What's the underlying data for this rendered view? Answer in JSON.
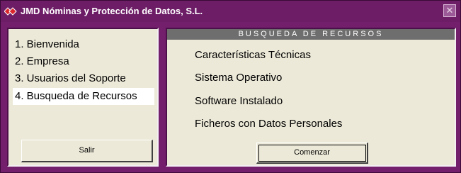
{
  "window": {
    "title": "JMD Nóminas y Protección de Datos, S.L.",
    "close_label": "✕"
  },
  "steps": [
    {
      "label": "1. Bienvenida"
    },
    {
      "label": "2. Empresa"
    },
    {
      "label": "3. Usuarios del Soporte"
    },
    {
      "label": "4. Busqueda de Recursos"
    }
  ],
  "active_step": 4,
  "left_panel": {
    "exit_label": "Salir"
  },
  "right_panel": {
    "header": "BUSQUEDA DE RECURSOS",
    "resources": [
      {
        "label": "Características Técnicas"
      },
      {
        "label": "Sistema Operativo"
      },
      {
        "label": "Software Instalado"
      },
      {
        "label": "Ficheros con Datos Personales"
      }
    ],
    "start_label": "Comenzar"
  },
  "colors": {
    "window_frame": "#731f6c",
    "panel_bg": "#ece9d8",
    "header_bg": "#6e6e6e",
    "active_step_bg": "#ffffff",
    "icon_red": "#d8262c"
  },
  "icons": {
    "app": "red-diamonds-icon",
    "close": "close-icon"
  }
}
